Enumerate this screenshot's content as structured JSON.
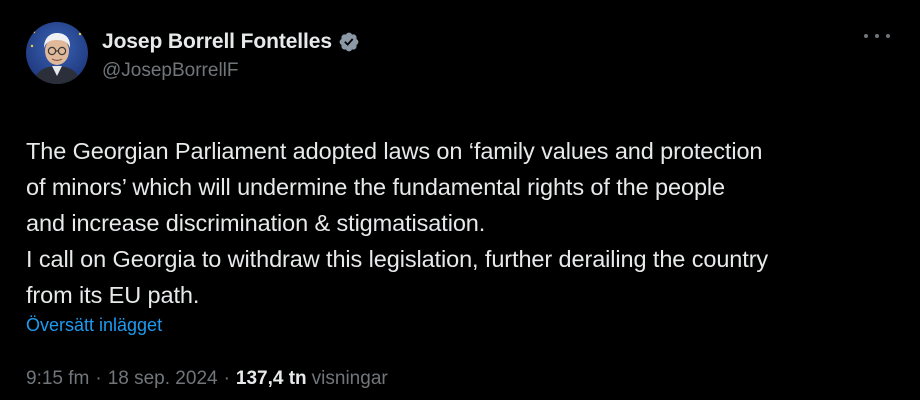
{
  "author": {
    "display_name": "Josep Borrell Fontelles",
    "handle": "@JosepBorrellF",
    "verified_icon": "verified-badge-icon",
    "verified_color": "#8b98a5"
  },
  "menu": {
    "more_icon": "more-horizontal-icon"
  },
  "post": {
    "text": "The Georgian Parliament adopted laws on ‘family values and protection\nof minors’ which will undermine the fundamental rights of the people\nand increase discrimination & stigmatisation.\nI call on Georgia to withdraw this legislation, further derailing the country\nfrom its EU path.",
    "translate_label": "Översätt inlägget"
  },
  "meta": {
    "time": "9:15 fm",
    "separator": "·",
    "date": "18 sep. 2024",
    "views_count": "137,4 tn",
    "views_label": "visningar"
  },
  "colors": {
    "background": "#000000",
    "primary_text": "#e7e9ea",
    "secondary_text": "#71767b",
    "link": "#1d9bf0"
  }
}
